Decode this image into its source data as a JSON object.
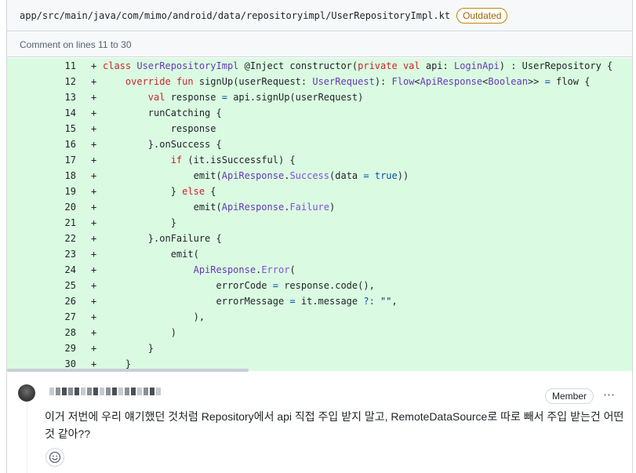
{
  "file": {
    "path": "app/src/main/java/com/mimo/android/data/repositoryimpl/UserRepositoryImpl.kt",
    "status_badge": "Outdated",
    "comment_range": "Comment on lines 11 to 30"
  },
  "code_lines": [
    {
      "n": "11",
      "sign": "+",
      "text": "class UserRepositoryImpl @Inject constructor(private val api: LoginApi) : UserRepository {"
    },
    {
      "n": "12",
      "sign": "+",
      "text": "    override fun signUp(userRequest: UserRequest): Flow<ApiResponse<Boolean>> = flow {"
    },
    {
      "n": "13",
      "sign": "+",
      "text": "        val response = api.signUp(userRequest)"
    },
    {
      "n": "14",
      "sign": "+",
      "text": "        runCatching {"
    },
    {
      "n": "15",
      "sign": "+",
      "text": "            response"
    },
    {
      "n": "16",
      "sign": "+",
      "text": "        }.onSuccess {"
    },
    {
      "n": "17",
      "sign": "+",
      "text": "            if (it.isSuccessful) {"
    },
    {
      "n": "18",
      "sign": "+",
      "text": "                emit(ApiResponse.Success(data = true))"
    },
    {
      "n": "19",
      "sign": "+",
      "text": "            } else {"
    },
    {
      "n": "20",
      "sign": "+",
      "text": "                emit(ApiResponse.Failure)"
    },
    {
      "n": "21",
      "sign": "+",
      "text": "            }"
    },
    {
      "n": "22",
      "sign": "+",
      "text": "        }.onFailure {"
    },
    {
      "n": "23",
      "sign": "+",
      "text": "            emit("
    },
    {
      "n": "24",
      "sign": "+",
      "text": "                ApiResponse.Error("
    },
    {
      "n": "25",
      "sign": "+",
      "text": "                    errorCode = response.code(),"
    },
    {
      "n": "26",
      "sign": "+",
      "text": "                    errorMessage = it.message ?: \"\","
    },
    {
      "n": "27",
      "sign": "+",
      "text": "                ),"
    },
    {
      "n": "28",
      "sign": "+",
      "text": "            )"
    },
    {
      "n": "29",
      "sign": "+",
      "text": "        }"
    },
    {
      "n": "30",
      "sign": "+",
      "text": "    }"
    }
  ],
  "comment": {
    "author_role": "Member",
    "more_icon": "kebab-horizontal-icon",
    "body": "이거 저번에 우리 얘기했던 것처럼 Repository에서 api 직접 주입 받지 말고, RemoteDataSource로 따로 빼서 주입 받는건 어떤 것 같아??",
    "reaction_icon": "smiley-icon"
  },
  "colors": {
    "added_line_bg": "#dafbe1",
    "keyword": "#cf222e",
    "type": "#6639ba",
    "outdated": "#9a6700"
  }
}
